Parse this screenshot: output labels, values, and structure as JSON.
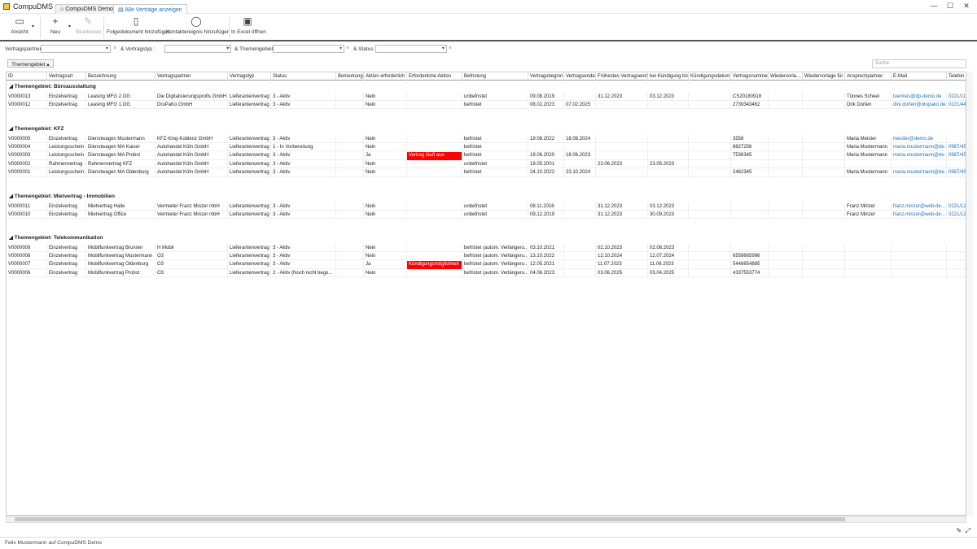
{
  "app": {
    "title": "CompuDMS"
  },
  "tabs": [
    {
      "label": "CompuDMS Demo"
    },
    {
      "label": "Alle Verträge anzeigen"
    }
  ],
  "window": {
    "minimize": "—",
    "maximize": "☐",
    "close": "✕"
  },
  "ribbon": {
    "ansicht": "Ansicht",
    "neu": "Neu",
    "bearbeiten": "Bearbeiten",
    "folgedokument": "Folgedokument hinzufügen",
    "kontaktereignis": "Kontaktereignis hinzufügen",
    "excel": "In Excel öffnen"
  },
  "filters": {
    "vertragspartner": "Vertragspartner :",
    "vertragstyp": "& Vertragstyp :",
    "themengebiet": "& Themengebiet :",
    "status": "& Status :"
  },
  "grouping": {
    "chip": "Themengebiet ▴",
    "search_placeholder": "Suche"
  },
  "columns": [
    "ID",
    "Vertragsart",
    "Bezeichnung",
    "Vertragspartner",
    "Vertragstyp",
    "Status",
    "Bemerkung",
    "Aktion erforderlich",
    "Erforderliche Aktion",
    "Befristung",
    "Vertragsbeginn",
    "Vertragsende",
    "Frühestes Vertragsende",
    "bei Kündigung bis",
    "Kündigungsdatum",
    "Vertragsnummer",
    "Wiedervorla...",
    "Wiedervorlage für",
    "Ansprechpartner",
    "E-Mail",
    "Telefon"
  ],
  "groups": [
    {
      "title": "◢ Themengebiet: Büroausstattung",
      "rows": [
        [
          "V0000013",
          "Einzelvertrag",
          "Leasing MFG 2.OG",
          "Die Digitalisierungsprofis GmbH",
          "Lieferantenvertrag",
          "3 - Aktiv",
          "",
          "Nein",
          "",
          "unbefristet",
          "09.08.2019",
          "",
          "31.12.2023",
          "03.12.2023",
          "",
          "CS20180918",
          "",
          "",
          "Tünnes Scheel",
          "tuennes@dp-demo.de",
          "0221/11"
        ],
        [
          "V0000012",
          "Einzelvertrag",
          "Leasing MFG 1.OG",
          "DruPaKo GmbH",
          "Lieferantenvertrag",
          "3 - Aktiv",
          "",
          "Nein",
          "",
          "befristet",
          "08.02.2023",
          "07.02.2025",
          "",
          "",
          "",
          "2739343462",
          "",
          "",
          "Dirk Dorten",
          "dirk.dorten@drupako.de",
          "0221/44"
        ]
      ]
    },
    {
      "title": "◢ Themengebiet: KFZ",
      "rows": [
        [
          "V0000005",
          "Einzelvertrag",
          "Dienstwagen Mustermann",
          "KFZ-King-Koblenz GmbH",
          "Lieferantenvertrag",
          "3 - Aktiv",
          "",
          "Nein",
          "",
          "befristet",
          "19.08.2022",
          "18.08.2024",
          "",
          "",
          "",
          "3558",
          "",
          "",
          "Maria Meister",
          "mesiter@demo.de",
          ""
        ],
        [
          "V0000004",
          "Leistungsschein",
          "Dienstwagen MA Kaiser",
          "Autohandel Köln GmbH",
          "Lieferantenvertrag",
          "1 - In Vorbereitung",
          "",
          "Nein",
          "",
          "befristet",
          "",
          "",
          "",
          "",
          "",
          "8627256",
          "",
          "",
          "Maria Mustermann",
          "maria.mustermann@de...",
          "0987/45"
        ],
        [
          "V0000003",
          "Leistungsschein",
          "Dienstwagen MA Probst",
          "Autohandel Köln GmbH",
          "Lieferantenvertrag",
          "3 - Aktiv",
          "",
          "Ja",
          "Vertrag läuft aus",
          "befristet",
          "19.06.2020",
          "18.06.2023",
          "",
          "",
          "",
          "7536345",
          "",
          "",
          "Maria Mustermann",
          "maria.mustermann@de...",
          "0987/45"
        ],
        [
          "V0000002",
          "Rahmenvertrag",
          "Rahmenvertrag KFZ",
          "Autohandel Köln GmbH",
          "Lieferantenvertrag",
          "3 - Aktiv",
          "",
          "Nein",
          "",
          "unbefristet",
          "18.05.2001",
          "",
          "23.06.2023",
          "23.05.2023",
          "",
          "",
          "",
          "",
          "",
          "",
          ""
        ],
        [
          "V0000001",
          "Leistungsschein",
          "Dienstwagen MA Oldenburg",
          "Autohandel Köln GmbH",
          "Lieferantenvertrag",
          "3 - Aktiv",
          "",
          "Nein",
          "",
          "befristet",
          "24.10.2022",
          "23.10.2024",
          "",
          "",
          "",
          "2462345",
          "",
          "",
          "Maria Mustermann",
          "maria.mustermann@de...",
          "0987/45"
        ]
      ]
    },
    {
      "title": "◢ Themengebiet: Mietvertrag - Immobilien",
      "rows": [
        [
          "V0000011",
          "Einzelvertrag",
          "Mietvertrag Halle",
          "Vermieter Franz Minzer mbH",
          "Lieferantenvertrag",
          "3 - Aktiv",
          "",
          "Nein",
          "",
          "unbefristet",
          "08.11.2016",
          "",
          "31.12.2023",
          "03.12.2023",
          "",
          "",
          "",
          "",
          "Franz Minzer",
          "franz.minzer@web-de...",
          "0221/12"
        ],
        [
          "V0000010",
          "Einzelvertrag",
          "Mietvertrag Office",
          "Vermieter Franz Minzer mbH",
          "Lieferantenvertrag",
          "3 - Aktiv",
          "",
          "Nein",
          "",
          "unbefristet",
          "09.12.2019",
          "",
          "31.12.2023",
          "30.09.2023",
          "",
          "",
          "",
          "",
          "Franz Minzer",
          "franz.minzer@web-de...",
          "0221/12"
        ]
      ]
    },
    {
      "title": "◢ Themengebiet: Telekommunikation",
      "rows": [
        [
          "V0000009",
          "Einzelvertrag",
          "Mobilfunkvertrag Brunner",
          "H Mobil",
          "Lieferantenvertrag",
          "3 - Aktiv",
          "",
          "Nein",
          "",
          "befristet (autom. Verlängeru...",
          "03.10.2021",
          "",
          "02.10.2023",
          "02.08.2023",
          "",
          "",
          "",
          "",
          "",
          "",
          ""
        ],
        [
          "V0000008",
          "Einzelvertrag",
          "Mobilfunkvertrag Mustermann",
          "O3",
          "Lieferantenvertrag",
          "3 - Aktiv",
          "",
          "Nein",
          "",
          "befristet (autom. Verlängeru...",
          "13.10.2022",
          "",
          "12.10.2024",
          "12.07.2024",
          "",
          "6559665996",
          "",
          "",
          "",
          "",
          ""
        ],
        [
          "V0000007",
          "Einzelvertrag",
          "Mobilfunkvertrag Oldenburg",
          "O3",
          "Lieferantenvertrag",
          "3 - Aktiv",
          "",
          "Ja",
          "Kündigungsmöglichkeit",
          "befristet (autom. Verlängeru...",
          "12.05.2021",
          "",
          "11.07.2023",
          "11.06.2023",
          "",
          "5448654885",
          "",
          "",
          "",
          "",
          ""
        ],
        [
          "V0000006",
          "Einzelvertrag",
          "Mobilfunkvertrag Probst",
          "O3",
          "Lieferantenvertrag",
          "2 - Aktiv (Noch nicht bego...",
          "",
          "Nein",
          "",
          "befristet (autom. Verlängeru...",
          "04.06.2023",
          "",
          "03.06.2025",
          "03.04.2025",
          "",
          "4337553774",
          "",
          "",
          "",
          "",
          ""
        ]
      ]
    }
  ],
  "status_bar": {
    "text": "Felix Mustermann auf CompuDMS Demo"
  },
  "colors": {
    "accent": "#1f6fb5",
    "alert": "#ff0000"
  }
}
